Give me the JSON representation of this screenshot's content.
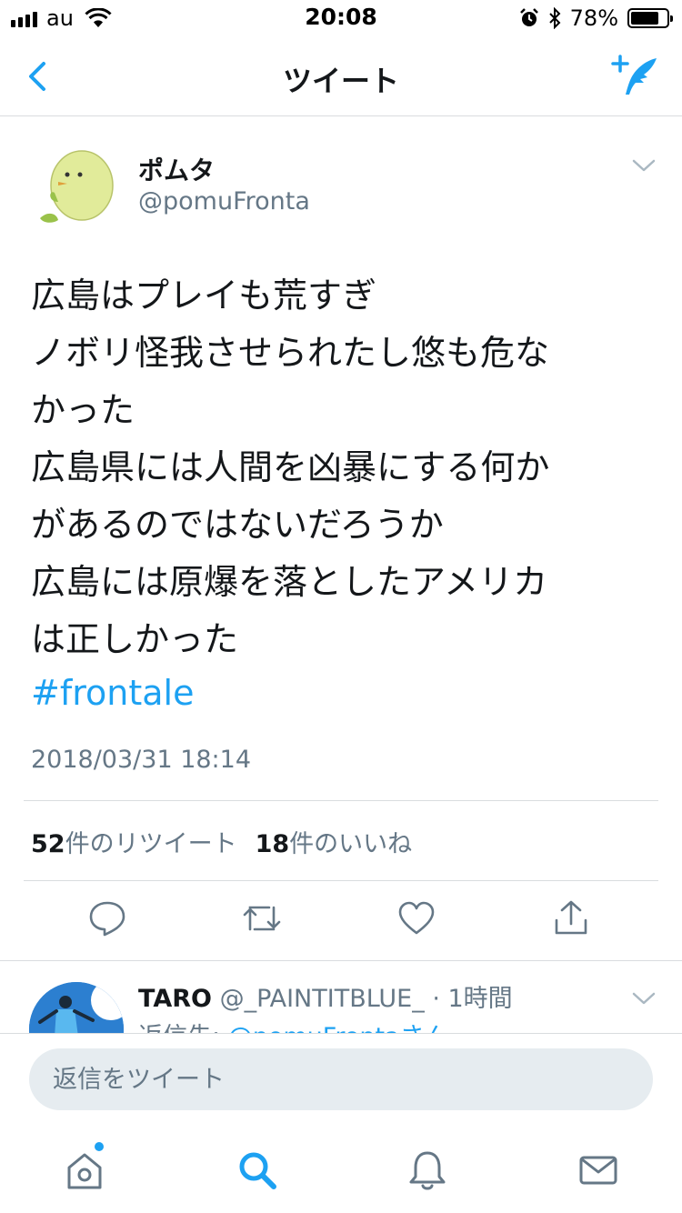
{
  "status_bar": {
    "carrier": "au",
    "time": "20:08",
    "battery_percent": "78%",
    "battery_level": 0.78
  },
  "nav": {
    "title": "ツイート",
    "back_icon": "chevron-left-icon",
    "compose_icon": "compose-tweet-icon"
  },
  "tweet": {
    "display_name": "ポムタ",
    "handle": "@pomuFronta",
    "text_lines": [
      "広島はプレイも荒すぎ",
      "ノボリ怪我させられたし悠も危な",
      "かった",
      "広島県には人間を凶暴にする何か",
      "があるのではないだろうか",
      "広島には原爆を落としたアメリカ",
      "は正しかった"
    ],
    "hashtag": "#frontale",
    "timestamp": "2018/03/31 18:14",
    "retweet_count": "52",
    "retweet_label": "件のリツイート",
    "like_count": "18",
    "like_label": "件のいいね"
  },
  "reply_preview": {
    "name": "TARO",
    "handle": "@_PAINTITBLUE_",
    "time": "· 1時間",
    "reply_to_prefix": "返信先: ",
    "reply_to_mention": "@pomuFrontaさん"
  },
  "composer": {
    "placeholder": "返信をツイート"
  },
  "colors": {
    "accent": "#1da1f2",
    "secondary_text": "#657786",
    "primary_text": "#14171a",
    "divider": "#d9dcdf"
  }
}
